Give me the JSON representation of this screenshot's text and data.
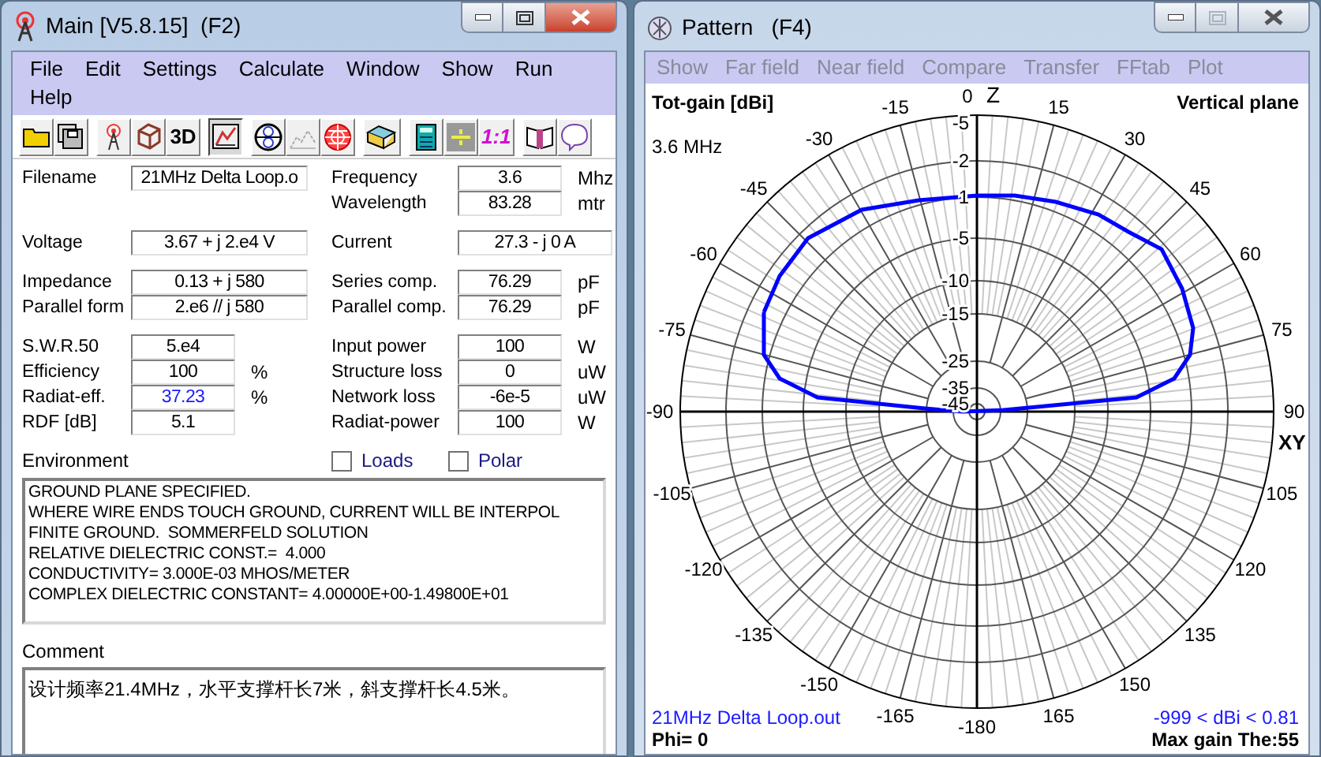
{
  "main_window": {
    "title": "Main [V5.8.15]  (F2)",
    "menu": [
      {
        "label": "File"
      },
      {
        "label": "Edit"
      },
      {
        "label": "Settings"
      },
      {
        "label": "Calculate"
      },
      {
        "label": "Window"
      },
      {
        "label": "Show"
      },
      {
        "label": "Run"
      },
      {
        "label": "Help"
      }
    ],
    "toolbar": [
      {
        "selected": false
      },
      {
        "selected": false
      },
      {
        "selected": false
      },
      {
        "selected": false
      },
      {
        "label": "3D",
        "selected": false
      },
      {
        "selected": true
      },
      {
        "selected": false
      },
      {
        "selected": false
      },
      {
        "selected": false
      },
      {
        "selected": false
      },
      {
        "selected": false
      },
      {
        "selected": false
      },
      {
        "label": "1:1",
        "selected": false
      },
      {
        "selected": false
      },
      {
        "selected": false
      }
    ],
    "field_groups": [
      [
        {
          "left": {
            "label": "Filename",
            "value": "21MHz Delta Loop.o",
            "highlighted": false
          },
          "right": {
            "label": "Frequency",
            "value": "3.6",
            "unit": "Mhz"
          }
        },
        {
          "right": {
            "label": "Wavelength",
            "value": "83.28",
            "unit": "mtr"
          }
        }
      ],
      [
        {
          "left": {
            "label": "Voltage",
            "value": "3.67 + j 2.e4 V",
            "highlighted": false
          },
          "right": {
            "label": "Current",
            "value": "27.3 - j 0 A"
          }
        }
      ],
      [
        {
          "left": {
            "label": "Impedance",
            "value": "0.13 + j 580",
            "highlighted": false
          },
          "right": {
            "label": "Series comp.",
            "value": "76.29",
            "unit": "pF"
          }
        },
        {
          "left": {
            "label": "Parallel form",
            "value": "2.e6 // j 580",
            "highlighted": false
          },
          "right": {
            "label": "Parallel comp.",
            "value": "76.29",
            "unit": "pF"
          }
        }
      ],
      [
        {
          "left": {
            "label": "S.W.R.50",
            "value": "5.e4",
            "highlighted": false
          },
          "right": {
            "label": "Input power",
            "value": "100",
            "unit": "W"
          }
        },
        {
          "left": {
            "label": "Efficiency",
            "value": "100",
            "unit": "%",
            "highlighted": false
          },
          "right": {
            "label": "Structure loss",
            "value": "0",
            "unit": "uW"
          }
        },
        {
          "left": {
            "label": "Radiat-eff.",
            "value": "37.23",
            "unit": "%",
            "highlighted": true
          },
          "right": {
            "label": "Network loss",
            "value": "-6e-5",
            "unit": "uW"
          }
        },
        {
          "left": {
            "label": "RDF [dB]",
            "value": "5.1",
            "highlighted": false
          },
          "right": {
            "label": "Radiat-power",
            "value": "100",
            "unit": "W"
          }
        }
      ]
    ],
    "environment": {
      "label": "Environment",
      "lines": [
        "GROUND PLANE SPECIFIED.",
        "WHERE WIRE ENDS TOUCH GROUND, CURRENT WILL BE INTERPOL",
        "FINITE GROUND.  SOMMERFELD SOLUTION",
        "RELATIVE DIELECTRIC CONST.=  4.000",
        "CONDUCTIVITY= 3.000E-03 MHOS/METER",
        "COMPLEX DIELECTRIC CONSTANT= 4.00000E+00-1.49800E+01"
      ]
    },
    "checkboxes": [
      {
        "label": "Loads",
        "checked": false
      },
      {
        "label": "Polar",
        "checked": false
      }
    ],
    "comment": {
      "label": "Comment",
      "value": "设计频率21.4MHz，水平支撑杆长7米，斜支撑杆长4.5米。"
    }
  },
  "pattern_window": {
    "title": "Pattern   (F4)",
    "menu": [
      {
        "label": "Show",
        "disabled": true
      },
      {
        "label": "Far field",
        "disabled": true
      },
      {
        "label": "Near field",
        "disabled": true
      },
      {
        "label": "Compare",
        "disabled": true
      },
      {
        "label": "Transfer",
        "disabled": true
      },
      {
        "label": "FFtab",
        "disabled": true
      },
      {
        "label": "Plot",
        "disabled": true
      }
    ],
    "plot": {
      "quantity": "Tot-gain [dBi]",
      "plane": "Vertical plane",
      "frequency": "3.6 MHz",
      "vertical_axis": "Z",
      "horizontal_axis": "XY",
      "angle_labels": [
        "0",
        "-15",
        "15",
        "-30",
        "30",
        "-45",
        "45",
        "-60",
        "60",
        "-75",
        "75",
        "-90",
        "90",
        "-105",
        "105",
        "-120",
        "120",
        "-135",
        "135",
        "-150",
        "150",
        "-165",
        "165",
        "-180"
      ],
      "ring_labels": [
        "-5",
        "-2",
        "1",
        "-5",
        "-10",
        "-15",
        "-25",
        "-35",
        "-45"
      ],
      "file": "21MHz Delta Loop.out",
      "range": "-999 < dBi < 0.81",
      "phi": "Phi= 0",
      "max_gain": "Max gain The:55"
    }
  }
}
